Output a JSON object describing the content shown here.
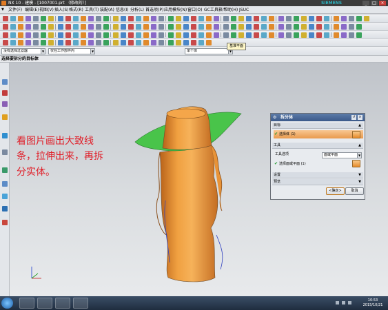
{
  "window": {
    "title": "NX 10 - 建模 - [1007001.prt （修改的）]",
    "brand": "SIEMENS",
    "buttons": [
      "_",
      "□",
      "×"
    ]
  },
  "menubar": {
    "items": [
      "文件(F)",
      "编辑(E)",
      "视图(V)",
      "插入(S)",
      "格式(R)",
      "工具(T)",
      "装配(A)",
      "信息(I)",
      "分析(L)",
      "首选项(P)",
      "应用模块(N)",
      "窗口(O)",
      "GC工具箱",
      "帮助(H)",
      "JSUC"
    ]
  },
  "filterbar": {
    "type_filter": "没有选择过滤器",
    "scope": "仅在工作部件内",
    "body_rule": "单个体"
  },
  "cue_line": "选择要拆分的目标体",
  "annotation": {
    "lines": [
      "看图片画出大致线",
      "条，拉伸出来，再拆",
      "分实体。"
    ]
  },
  "tooltip": "基准平面",
  "dialog": {
    "title": "拆分体",
    "target_section": "目标",
    "target_select": "选择体 (1)",
    "tool_section": "工具",
    "tool_option_label": "工具选项",
    "tool_option_value": "面或平面",
    "tool_select": "选择面或平面 (1)",
    "settings_section": "设置",
    "preview_section": "预览",
    "ok": "<确定>",
    "cancel": "取消"
  },
  "taskbar": {
    "time": "10:53",
    "date": "2015/10/21"
  },
  "colors": {
    "body_orange": "#e8902e",
    "plane_green": "#49c44a",
    "annotation_red": "#e0202a",
    "dialog_title": "#3c5a8a"
  },
  "icons": {
    "window": "nx-app-icon",
    "dialog": "gear-icon",
    "target_select": "solid-body-icon",
    "tool_select": "face-plane-icon"
  }
}
